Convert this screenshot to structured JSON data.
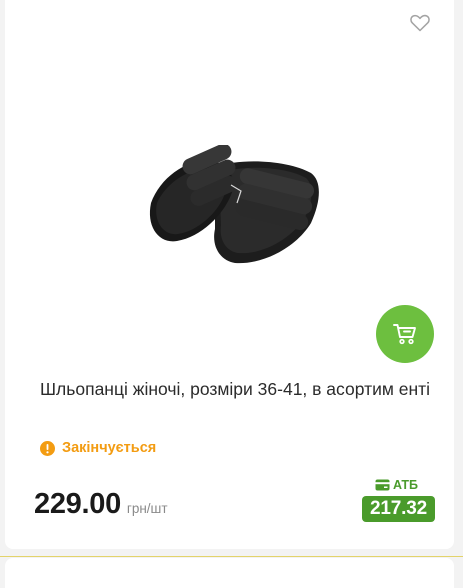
{
  "product": {
    "title": "Шльопанці жіночі, розміри 36-41, в асортим енті",
    "stock_status": "Закінчується",
    "price": "229.00",
    "price_unit": "грн/шт",
    "store_label": "АТБ",
    "store_price": "217.32"
  },
  "icons": {
    "favorite": "heart-outline-icon",
    "cart": "cart-icon",
    "warning": "exclamation-circle-icon",
    "card": "card-icon"
  },
  "colors": {
    "cart_button": "#6dbf3f",
    "stock_warning": "#f39c12",
    "atb_green": "#4a9b2b"
  }
}
